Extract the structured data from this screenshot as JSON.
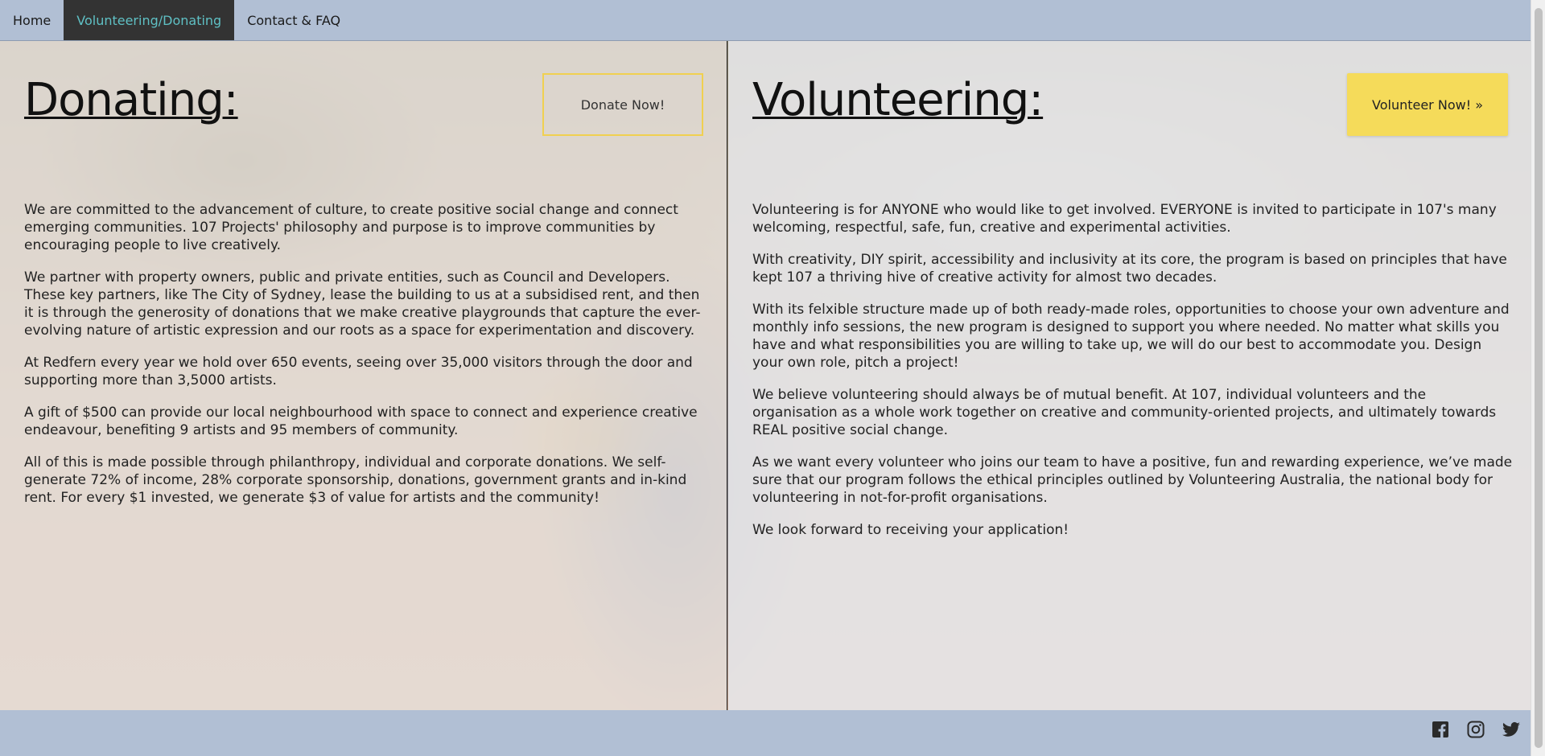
{
  "nav": {
    "items": [
      "Home",
      "Volunteering/Donating",
      "Contact & FAQ"
    ],
    "active": "Volunteering/Donating"
  },
  "donating": {
    "title": "Donating:",
    "button": "Donate Now!",
    "paragraphs": [
      "We are committed to the advancement of culture, to create positive social change and connect emerging communities. 107 Projects' philosophy and purpose is to improve communities by encouraging people to live creatively.",
      "We partner with property owners, public and private entities, such as Council and Developers. These key partners, like The City of Sydney, lease the building to us at a subsidised rent, and then it is through the generosity of donations that we make creative playgrounds that capture the ever-evolving nature of artistic expression and our roots as a space for experimentation and discovery.",
      "At Redfern every year we hold over 650 events, seeing over 35,000 visitors through the door and supporting more than 3,5000 artists.",
      "A gift of $500 can provide our local neighbourhood with space to connect and experience creative endeavour, benefiting 9 artists and 95 members of community.",
      "All of this is made possible through philanthropy, individual and corporate donations. We self-generate 72% of income, 28% corporate sponsorship, donations, government grants and in-kind rent. For every $1 invested, we generate $3 of value for artists and the community!"
    ]
  },
  "volunteering": {
    "title": "Volunteering:",
    "button": "Volunteer Now! »",
    "paragraphs": [
      "Volunteering is for ANYONE who would like to get involved. EVERYONE is invited to participate in 107's many welcoming, respectful, safe, fun, creative and experimental activities.",
      "With creativity, DIY spirit, accessibility and inclusivity at its core, the program is based on principles that have kept 107 a thriving hive of creative activity for almost two decades.",
      "With its felxible structure made up of both ready-made roles, opportunities to choose your own adventure and monthly info sessions, the new program is designed to support you where needed. No matter what skills you have and what responsibilities you are willing to take up, we will do our best to accommodate you. Design your own role, pitch a project!",
      "We believe volunteering should always be of mutual benefit. At 107, individual volunteers and the organisation as a whole work together on creative and community-oriented projects, and ultimately towards REAL positive social change.",
      "As we want every volunteer who joins our team to have a positive, fun and rewarding experience, we’ve made sure that our program follows the ethical principles outlined by Volunteering Australia, the national body for volunteering in not-for-profit organisations.",
      "We look forward to receiving your application!"
    ]
  },
  "footer": {
    "icons": [
      "facebook-icon",
      "instagram-icon",
      "twitter-icon"
    ]
  },
  "colors": {
    "nav_bg": "#b1bfd4",
    "nav_active_bg": "#333333",
    "nav_active_text": "#5fc0c4",
    "accent_yellow": "#f5db5a"
  }
}
